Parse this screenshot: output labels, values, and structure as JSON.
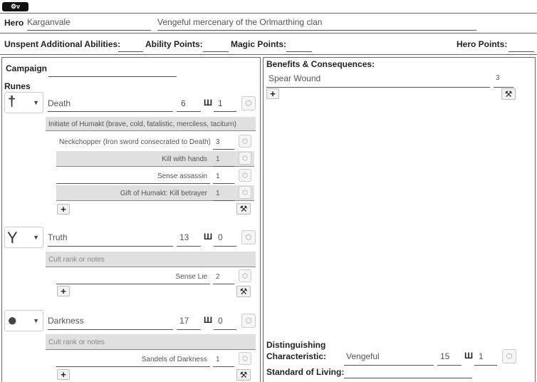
{
  "toggle_label": "⚙v",
  "hero": {
    "label": "Hero",
    "name": "Karganvale",
    "description": "Vengeful mercenary of the Orlmarthing clan"
  },
  "points": {
    "unspent": "Unspent Additional Abilities:",
    "ability": "Ability Points:",
    "magic": "Magic Points:",
    "hero": "Hero Points:"
  },
  "campaign": {
    "label": "Campaign",
    "value": ""
  },
  "runes_label": "Runes",
  "runes": [
    {
      "symbol": "†",
      "icon": "death-rune-icon",
      "name": "Death",
      "rating": "6",
      "mastery": "1",
      "note": "Initiate of Humakt (brave, cold, fatalistic, merciless, taciturn)",
      "subs": [
        {
          "name": "Neckchopper (Iron sword consecrated to Death)",
          "rating": "3"
        },
        {
          "name": "Kill with hands",
          "rating": "1"
        },
        {
          "name": "Sense assassin",
          "rating": "1"
        },
        {
          "name": "Gift of Humakt: Kill betrayer",
          "rating": "1"
        }
      ]
    },
    {
      "symbol": "Y",
      "icon": "truth-rune-icon",
      "name": "Truth",
      "rating": "13",
      "mastery": "0",
      "note": "Cult rank or notes",
      "subs": [
        {
          "name": "Sense Lie",
          "rating": "2"
        }
      ]
    },
    {
      "symbol": "●",
      "icon": "darkness-rune-icon",
      "name": "Darkness",
      "rating": "17",
      "mastery": "0",
      "note": "Cult rank or notes",
      "subs": [
        {
          "name": "Sandels of Darkness",
          "rating": "1"
        }
      ]
    }
  ],
  "benefits": {
    "label": "Benefits & Consequences:",
    "items": [
      {
        "name": "Spear Wound",
        "rating": "3"
      }
    ]
  },
  "distinguishing": {
    "label1": "Distinguishing",
    "label2": "Characteristic:",
    "value": "Vengeful",
    "rating": "15",
    "mastery": "1"
  },
  "standard": {
    "label": "Standard of Living:",
    "value": ""
  },
  "mastery_symbol": "Ш",
  "plus_symbol": "+",
  "tool_symbol": "⚒"
}
